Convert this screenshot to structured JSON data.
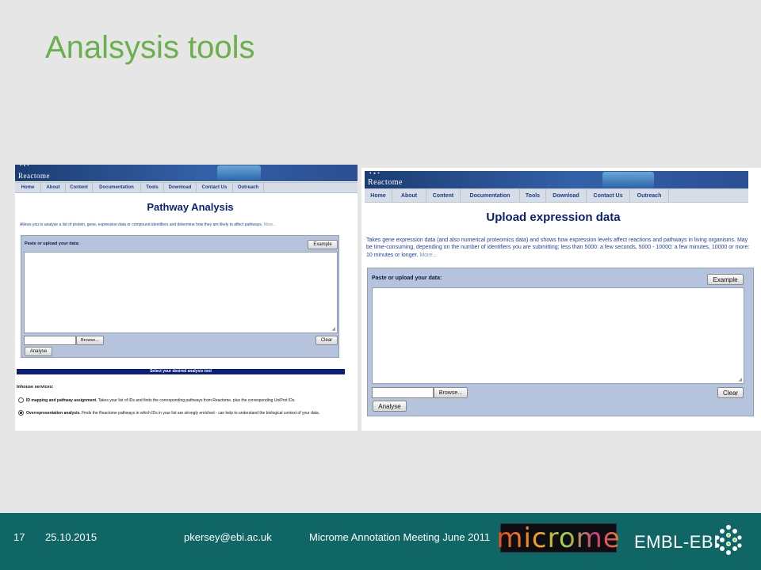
{
  "slide": {
    "title": "Analsysis tools"
  },
  "screenshot_left": {
    "logo_text": "Reactome",
    "nav": [
      "Home",
      "About",
      "Content",
      "Documentation",
      "Tools",
      "Download",
      "Contact Us",
      "Outreach"
    ],
    "heading": "Pathway Analysis",
    "description": "Allows you to analyse a list of protein, gene, expression data or compound identifiers and determine how they are likely to affect pathways.",
    "more_link": "More...",
    "panel_label": "Paste or upload your data:",
    "example_button": "Example",
    "browse_button": "Browse...",
    "clear_button": "Clear",
    "analyse_button": "Analyse",
    "select_tool_bar": "Select your desired analysis tool",
    "services_heading": "Inhouse services:",
    "service_1_title": "ID mapping and pathway assignment.",
    "service_1_text": "Takes your list of IDs and finds the corresponding pathways from Reactome, plus the corresponding UniProt IDs.",
    "service_2_title": "Overrepresentation analysis.",
    "service_2_text": "Finds the Reactome pathways in which IDs in your list are strongly enriched - can help to understand the biological context of your data.",
    "selected_service": 2
  },
  "screenshot_right": {
    "logo_text": "Reactome",
    "nav": [
      "Home",
      "About",
      "Content",
      "Documentation",
      "Tools",
      "Download",
      "Contact Us",
      "Outreach"
    ],
    "heading": "Upload expression data",
    "description": "Takes gene expression data (and also numerical proteomics data) and shows how expression levels affect reactions and pathways in living organisms. May be time-consuming, depending on the number of identifiers you are submitting; less than 5000: a few seconds, 5000 - 10000: a few minutes, 10000 or more: 10 minutes or longer.",
    "more_link": "More...",
    "panel_label": "Paste or upload your data:",
    "example_button": "Example",
    "browse_button": "Browse...",
    "clear_button": "Clear",
    "analyse_button": "Analyse"
  },
  "footer": {
    "page_number": "17",
    "date": "25.10.2015",
    "email": "pkersey@ebi.ac.uk",
    "meeting": "Microme Annotation Meeting June 2011",
    "microme_logo": "microme",
    "embl_logo": "EMBL-EBI"
  },
  "colors": {
    "title": "#6ab04c",
    "footer_bg": "#0f6665",
    "reactome_banner": "#2b4f94",
    "heading": "#0b1f75",
    "panel": "#b5c4dc",
    "select_bar": "#0a1f7a"
  }
}
